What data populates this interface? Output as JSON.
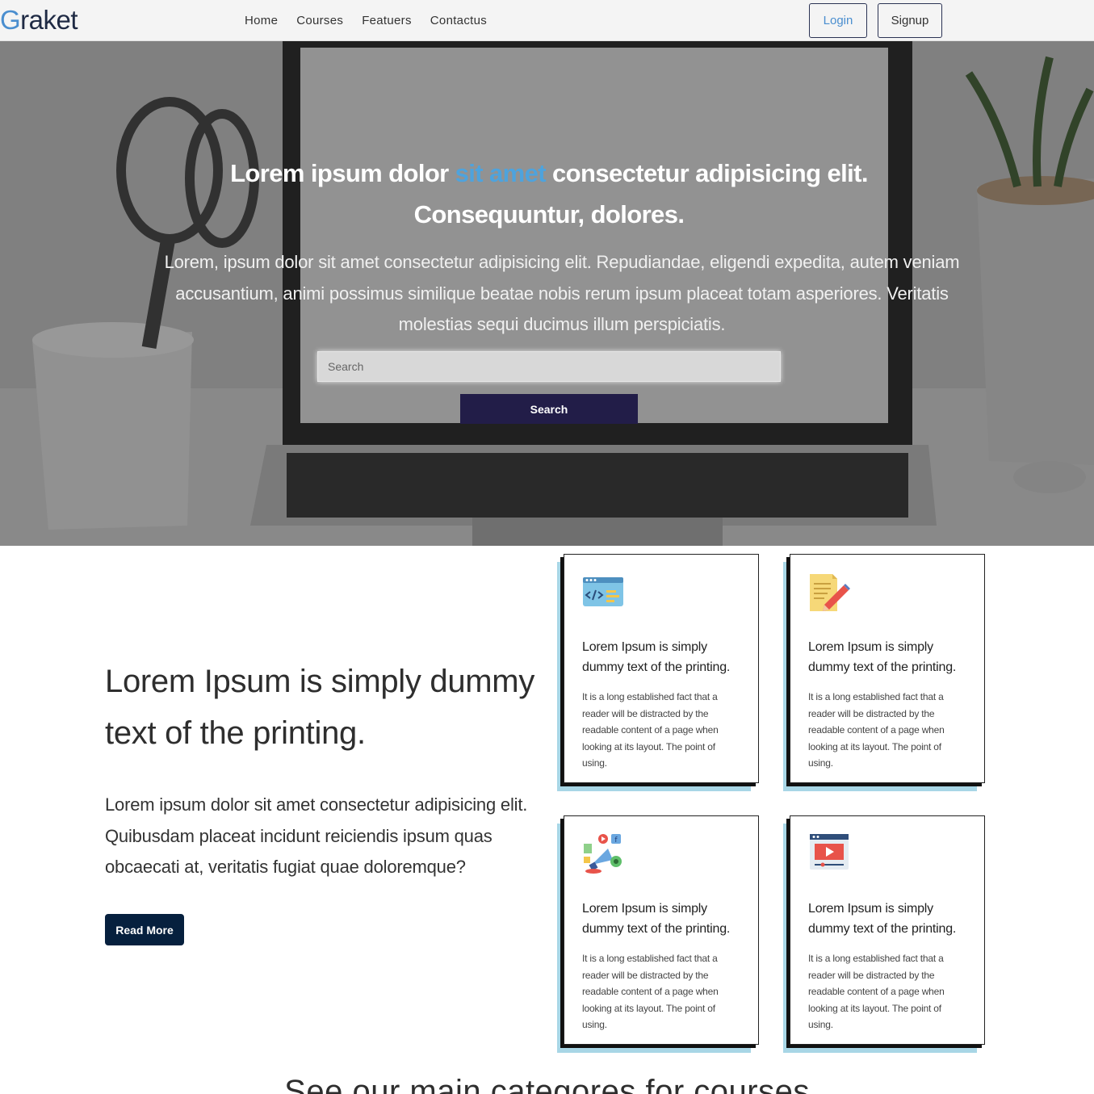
{
  "navbar": {
    "brand_initial": "G",
    "brand_rest": "raket",
    "links": [
      "Home",
      "Courses",
      "Featuers",
      "Contactus"
    ],
    "login_label": "Login",
    "signup_label": "Signup"
  },
  "hero": {
    "title_part1": "Lorem ipsum dolor ",
    "title_highlight": "sit amet",
    "title_part2": " consectetur adipisicing elit. Consequuntur, dolores.",
    "text": "Lorem, ipsum dolor sit amet consectetur adipisicing elit. Repudiandae, eligendi expedita, autem veniam accusantium, animi possimus similique beatae nobis rerum ipsum placeat totam asperiores. Veritatis molestias sequi ducimus illum perspiciatis.",
    "search_placeholder": "Search",
    "search_button": "Search"
  },
  "about": {
    "title": "Lorem Ipsum is simply dummy text of the printing.",
    "text": "Lorem ipsum dolor sit amet consectetur adipisicing elit. Quibusdam placeat incidunt reiciendis ipsum quas obcaecati at, veritatis fugiat quae doloremque?",
    "button": "Read More"
  },
  "cards": [
    {
      "icon": "code-window-icon",
      "title": "Lorem Ipsum is simply dummy text of the printing.",
      "text": "It is a long established fact that a reader will be distracted by the readable content of a page when looking at its layout. The point of using."
    },
    {
      "icon": "document-pencil-icon",
      "title": "Lorem Ipsum is simply dummy text of the printing.",
      "text": "It is a long established fact that a reader will be distracted by the readable content of a page when looking at its layout. The point of using."
    },
    {
      "icon": "marketing-megaphone-icon",
      "title": "Lorem Ipsum is simply dummy text of the printing.",
      "text": "It is a long established fact that a reader will be distracted by the readable content of a page when looking at its layout. The point of using."
    },
    {
      "icon": "video-player-icon",
      "title": "Lorem Ipsum is simply dummy text of the printing.",
      "text": "It is a long established fact that a reader will be distracted by the readable content of a page when looking at its layout. The point of using."
    }
  ],
  "categories": {
    "title": "See our main categores for courses"
  },
  "colors": {
    "accent": "#4a8ecf",
    "hero_button": "#221d48",
    "read_more": "#06203e",
    "card_shadow": "#a8d6e6"
  }
}
